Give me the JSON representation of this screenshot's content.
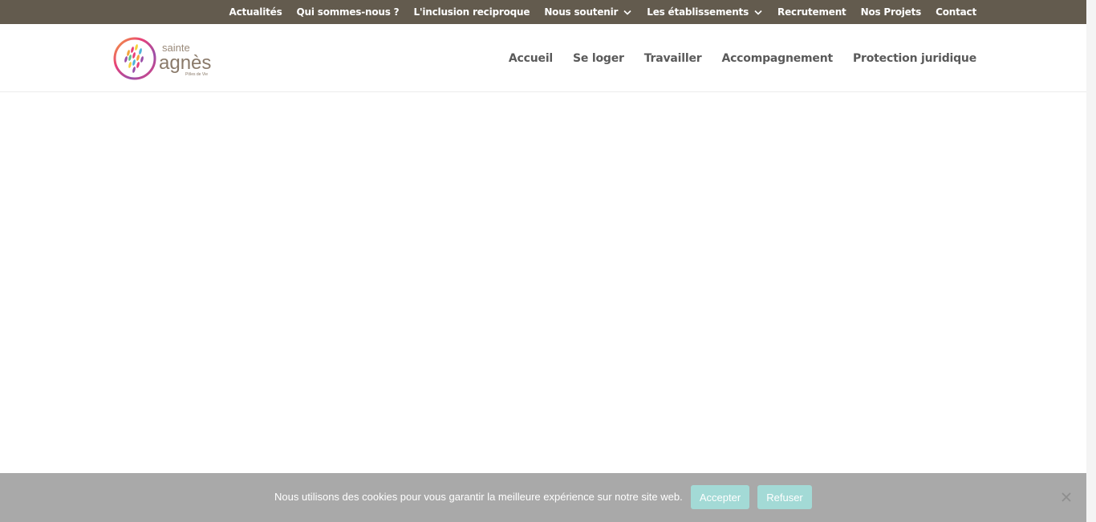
{
  "top_nav": {
    "items": [
      {
        "label": "Actualités",
        "has_dropdown": false
      },
      {
        "label": "Qui sommes-nous ?",
        "has_dropdown": false
      },
      {
        "label": "L'inclusion reciproque",
        "has_dropdown": false
      },
      {
        "label": "Nous soutenir",
        "has_dropdown": true
      },
      {
        "label": "Les établissements",
        "has_dropdown": true
      },
      {
        "label": "Recrutement",
        "has_dropdown": false
      },
      {
        "label": "Nos Projets",
        "has_dropdown": false
      },
      {
        "label": "Contact",
        "has_dropdown": false
      }
    ]
  },
  "logo": {
    "line1": "sainte",
    "line2": "agnès",
    "tagline": "Pôles de Vie"
  },
  "main_nav": {
    "items": [
      {
        "label": "Accueil"
      },
      {
        "label": "Se loger"
      },
      {
        "label": "Travailler"
      },
      {
        "label": "Accompagnement"
      },
      {
        "label": "Protection juridique"
      }
    ]
  },
  "cookie_banner": {
    "message": "Nous utilisons des cookies pour vous garantir la meilleure expérience sur notre site web.",
    "accept_label": "Accepter",
    "refuse_label": "Refuser"
  },
  "colors": {
    "top_bar": "#635b4e",
    "cookie_bar": "#a9a9a9",
    "cookie_button": "#a3dad6",
    "nav_text": "#5a5a5a"
  },
  "icons": {
    "dropdown": "chevron-down-icon",
    "close": "close-icon"
  }
}
